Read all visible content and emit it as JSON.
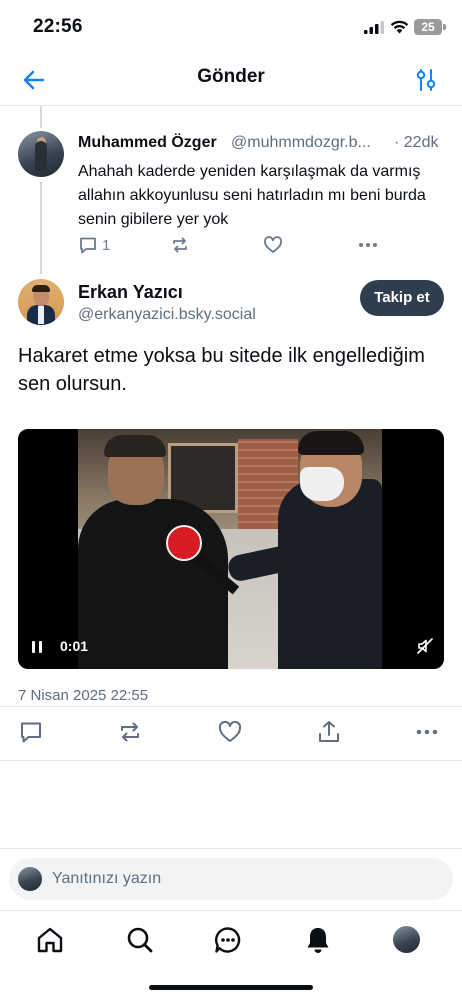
{
  "status_bar": {
    "time": "22:56",
    "battery": "25"
  },
  "header": {
    "title": "Gönder"
  },
  "reply_post": {
    "author_name": "Muhammed Özger",
    "author_handle": "@muhmmdozgr.b...",
    "time_ago": "· 22dk",
    "text": "Ahahah kaderde yeniden karşılaşmak da varmış allahın akkoyunlusu seni hatırladın mı beni burda senin gibilere yer yok",
    "reply_count": "1"
  },
  "main_post": {
    "author_name": "Erkan Yazıcı",
    "author_handle": "@erkanyazici.bsky.social",
    "follow_label": "Takip et",
    "text": "Hakaret etme yoksa bu sitede ilk engellediğim sen olursun.",
    "video_time": "0:01",
    "date": "7 Nisan 2025 22:55"
  },
  "reply_bar": {
    "placeholder": "Yanıtınızı yazın"
  },
  "tabs": [
    "home",
    "search",
    "chat",
    "notifications",
    "profile"
  ],
  "colors": {
    "accent": "#2f3e4e",
    "muted_text": "#5f6f80",
    "icon_gray": "#6b7c8e",
    "link_blue": "#1083fe"
  },
  "icons": {
    "back": "arrow-left-icon",
    "filter": "sliders-icon",
    "reply": "comment-icon",
    "repost": "repost-icon",
    "like": "heart-icon",
    "more": "more-icon",
    "share": "share-icon",
    "pause": "pause-icon",
    "mute": "mute-icon"
  }
}
